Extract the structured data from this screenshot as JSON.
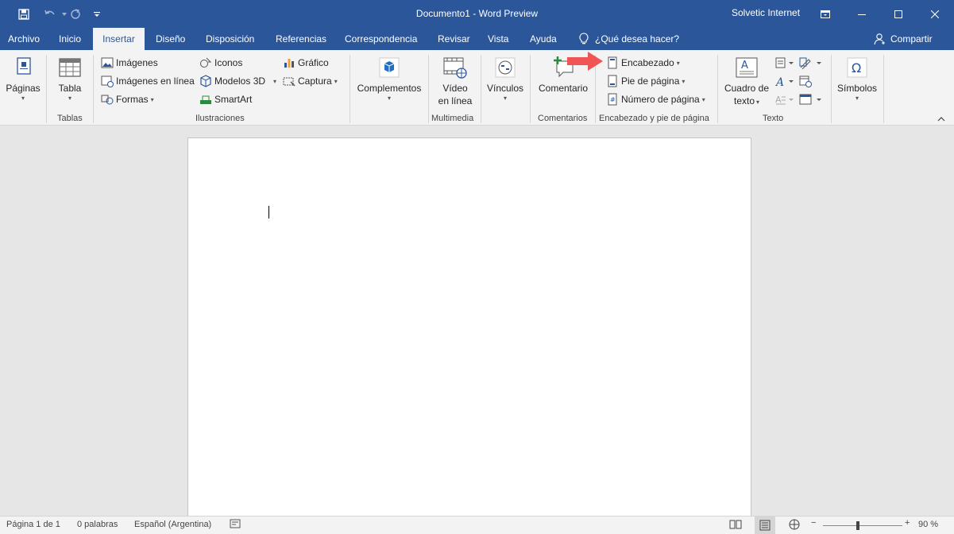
{
  "window": {
    "title": "Documento1  -  Word Preview",
    "user": "Solvetic Internet"
  },
  "tabs": [
    {
      "label": "Archivo"
    },
    {
      "label": "Inicio"
    },
    {
      "label": "Insertar"
    },
    {
      "label": "Diseño"
    },
    {
      "label": "Disposición"
    },
    {
      "label": "Referencias"
    },
    {
      "label": "Correspondencia"
    },
    {
      "label": "Revisar"
    },
    {
      "label": "Vista"
    },
    {
      "label": "Ayuda"
    }
  ],
  "active_tab": "Insertar",
  "tellme": {
    "placeholder": "¿Qué desea hacer?"
  },
  "share": {
    "label": "Compartir"
  },
  "ribbon": {
    "paginas": {
      "label": "Páginas"
    },
    "tablas": {
      "tabla": "Tabla",
      "group": "Tablas"
    },
    "ilustraciones": {
      "imagenes": "Imágenes",
      "imagenes_linea": "Imágenes en línea",
      "formas": "Formas",
      "iconos": "Iconos",
      "modelos3d": "Modelos 3D",
      "smartart": "SmartArt",
      "grafico": "Gráfico",
      "captura": "Captura",
      "group": "Ilustraciones"
    },
    "complementos": {
      "label": "Complementos"
    },
    "multimedia": {
      "video_l1": "Vídeo",
      "video_l2": "en línea",
      "group": "Multimedia"
    },
    "vinculos": {
      "label": "Vínculos"
    },
    "comentarios": {
      "label": "Comentario",
      "group": "Comentarios"
    },
    "encabezado": {
      "encabezado": "Encabezado",
      "pie": "Pie de página",
      "numero": "Número de página",
      "group": "Encabezado y pie de página"
    },
    "texto": {
      "cuadro_l1": "Cuadro de",
      "cuadro_l2": "texto",
      "group": "Texto"
    },
    "simbolos": {
      "label": "Símbolos"
    }
  },
  "status": {
    "page": "Página 1 de 1",
    "words": "0 palabras",
    "language": "Español (Argentina)",
    "zoom": "90 %"
  },
  "colors": {
    "brand": "#2b579a",
    "ribbon": "#f3f3f3",
    "arrow": "#f05454"
  }
}
